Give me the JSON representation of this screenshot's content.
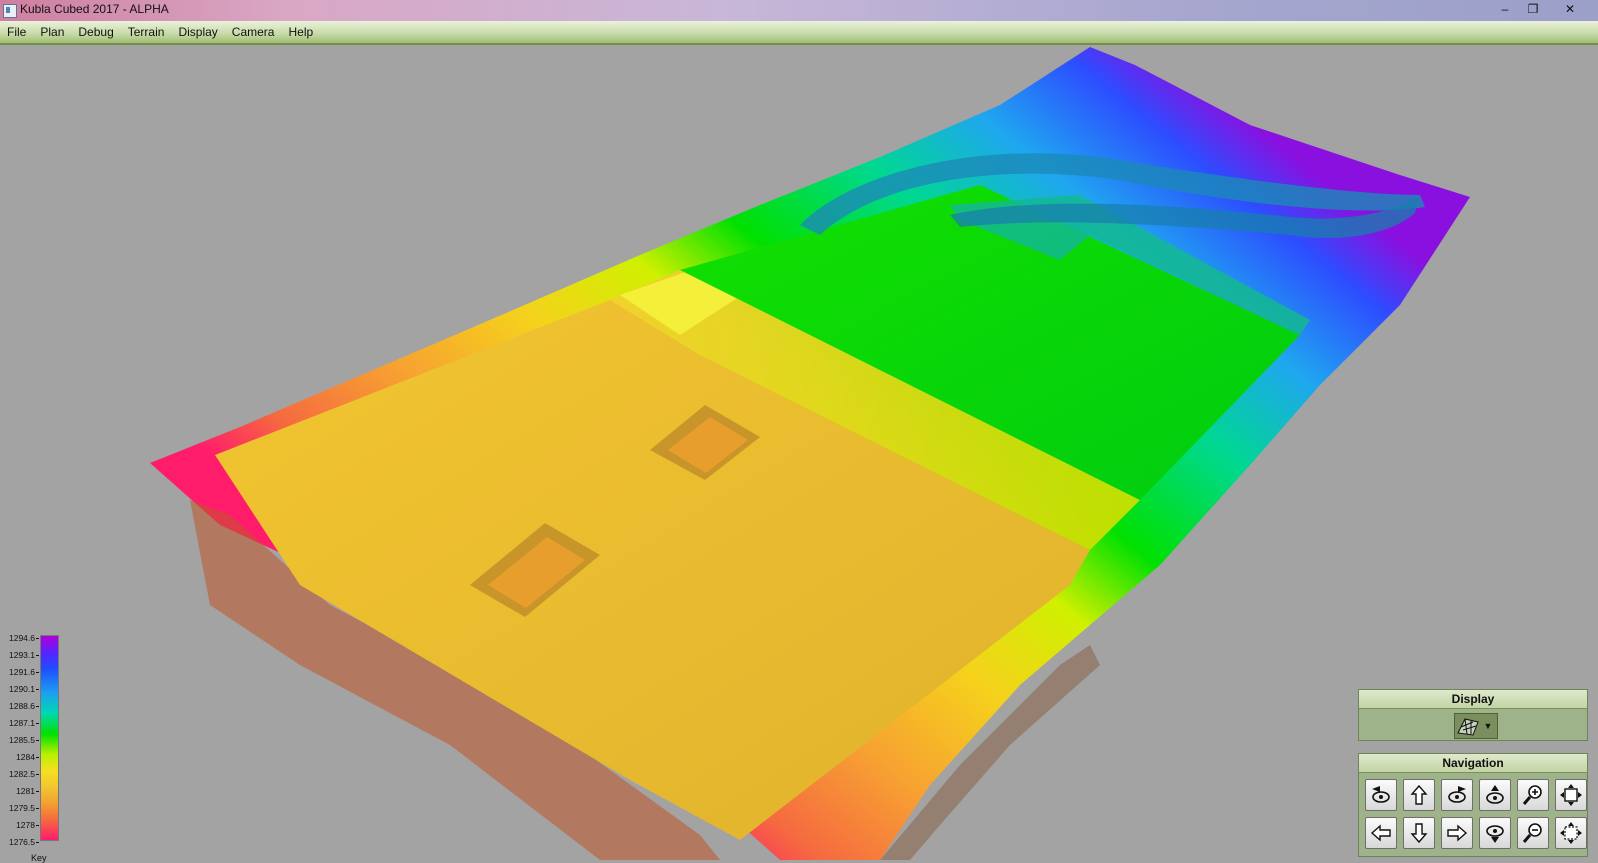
{
  "window": {
    "title": "Kubla Cubed 2017 - ALPHA",
    "controls": [
      "–",
      "❐",
      "✕"
    ]
  },
  "menu": [
    "File",
    "Plan",
    "Debug",
    "Terrain",
    "Display",
    "Camera",
    "Help"
  ],
  "key": {
    "title": "Key",
    "labels": [
      "1294.6",
      "1293.1",
      "1291.6",
      "1290.1",
      "1288.6",
      "1287.1",
      "1285.5",
      "1284",
      "1282.5",
      "1281",
      "1279.5",
      "1278",
      "1276.5"
    ],
    "colors": {
      "max": "#b000d8",
      "mid": "#00e000",
      "min": "#ff1c6a"
    }
  },
  "panels": {
    "display": {
      "title": "Display",
      "selected_icon": "terrain-mesh-icon"
    },
    "navigation": {
      "title": "Navigation",
      "buttons": [
        "orbit-left-icon",
        "pan-up-icon",
        "orbit-right-icon",
        "tilt-up-icon",
        "zoom-in-icon",
        "fit-view-icon",
        "pan-left-icon",
        "pan-down-icon",
        "pan-right-icon",
        "tilt-down-icon",
        "zoom-out-icon",
        "pan-all-icon"
      ]
    }
  },
  "colors": {
    "viewport_bg": "#a3a3a3",
    "menubar": "#c6d9a6",
    "panel_bg": "#9fb38a"
  }
}
